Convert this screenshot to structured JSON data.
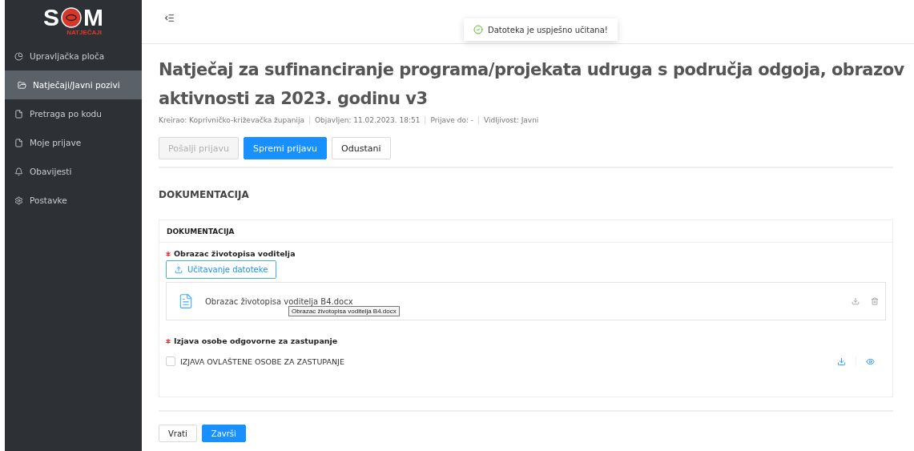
{
  "logo": {
    "name": "S",
    "name_end": "M",
    "subtitle": "NATJEČAJI"
  },
  "sidebar": {
    "items": [
      {
        "label": "Upravljačka ploča",
        "selected": false
      },
      {
        "label": "Natječaji/Javni pozivi",
        "selected": true
      },
      {
        "label": "Pretraga po kodu",
        "selected": false
      },
      {
        "label": "Moje prijave",
        "selected": false
      },
      {
        "label": "Obavijesti",
        "selected": false
      },
      {
        "label": "Postavke",
        "selected": false
      }
    ]
  },
  "toast": {
    "message": "Datoteka je uspješno učitana!"
  },
  "page": {
    "title_lines": [
      "Natječaj za sufinanciranje programa/projekata udruga s područja odgoja, obrazov",
      "aktivnosti za 2023. godinu v3"
    ],
    "meta": [
      "Kreirao: Koprivničko-križevačka županija",
      "Objavljen: 11.02.2023. 18:51",
      "Prijave do: -",
      "Vidljivost: Javni"
    ],
    "actions": [
      {
        "label": "Pošalji prijavu",
        "kind": "default",
        "disabled": true
      },
      {
        "label": "Spremi prijavu",
        "kind": "primary",
        "disabled": false
      },
      {
        "label": "Odustani",
        "kind": "default",
        "disabled": false
      }
    ],
    "section_title": "DOKUMENTACIJA",
    "card": {
      "title": "DOKUMENTACIJA",
      "fields": [
        {
          "kind": "upload",
          "label": "Obrazac životopisa voditelja",
          "required": true,
          "button": "Učitavanje datoteke",
          "file": "Obrazac životopisa voditelja B4.docx",
          "tooltip": "Obrazac životopisa voditelja B4.docx"
        },
        {
          "kind": "checkbox",
          "label": "Izjava osobe odgovorne za zastupanje",
          "required": true,
          "option": "IZJAVA OVLAŠTENE OSOBE ZA ZASTUPANJE",
          "checked": false
        }
      ]
    },
    "footer": [
      {
        "label": "Vrati",
        "kind": "default",
        "disabled": false
      },
      {
        "label": "Završi",
        "kind": "primary",
        "disabled": false
      }
    ]
  }
}
